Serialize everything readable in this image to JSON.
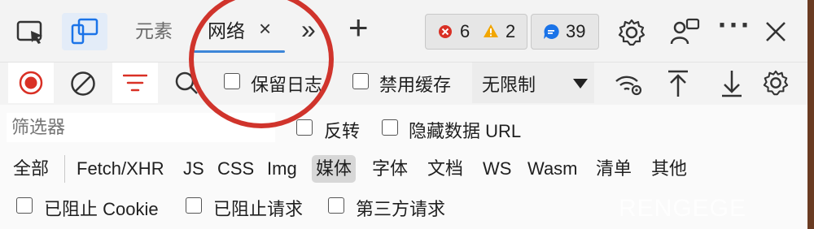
{
  "tabs": [
    {
      "label": "元素",
      "active": false
    },
    {
      "label": "网络",
      "active": true,
      "close": "×"
    }
  ],
  "more_tabs_glyph": "»",
  "add_tab_glyph": "+",
  "issues": {
    "errors": "6",
    "warnings": "2",
    "messages": "39"
  },
  "toolbar": {
    "preserve_log": "保留日志",
    "disable_cache": "禁用缓存",
    "throttling": "无限制"
  },
  "filter": {
    "placeholder": "筛选器",
    "invert": "反转",
    "hide_data_url": "隐藏数据 URL"
  },
  "types": [
    "全部",
    "Fetch/XHR",
    "JS",
    "CSS",
    "Img",
    "媒体",
    "字体",
    "文档",
    "WS",
    "Wasm",
    "清单",
    "其他"
  ],
  "active_type": "媒体",
  "blocking": {
    "blocked_cookies": "已阻止 Cookie",
    "blocked_requests": "已阻止请求",
    "third_party": "第三方请求"
  },
  "watermark": "RENGEGE",
  "colors": {
    "record_red": "#d93025",
    "filter_red": "#d93025",
    "tab_accent": "#3d86d8",
    "device_blue": "#1a73e8",
    "annotation": "#d0342c"
  }
}
